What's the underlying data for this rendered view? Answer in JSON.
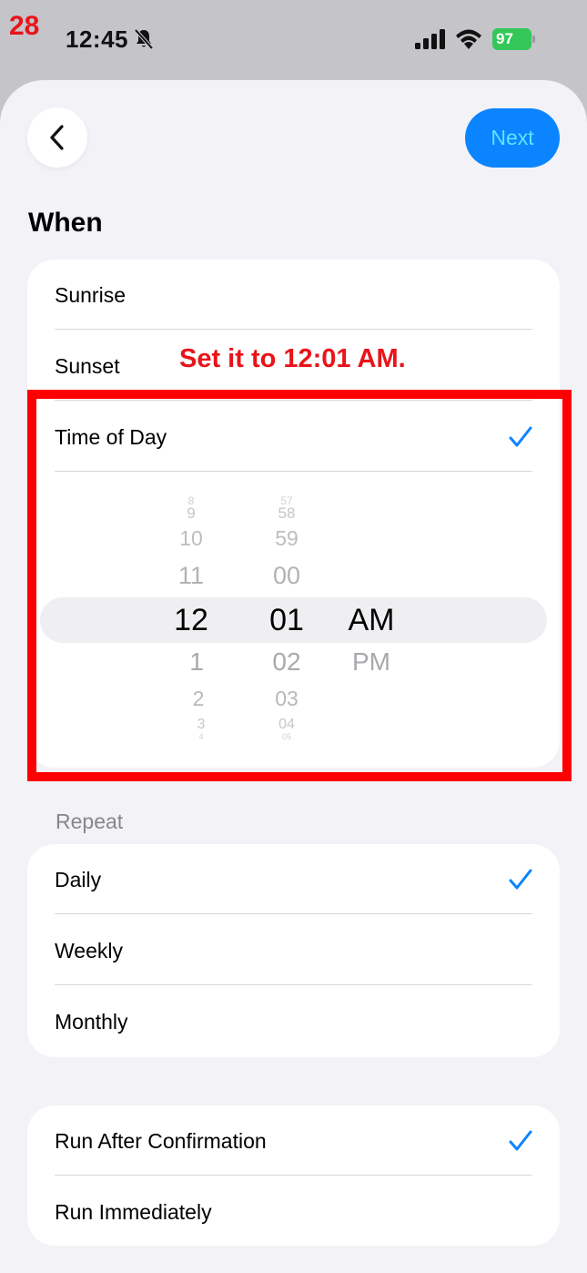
{
  "overlay": {
    "step_number": "28",
    "instruction": "Set it to 12:01 AM."
  },
  "status_bar": {
    "time": "12:45",
    "battery": "97"
  },
  "header": {
    "back_icon": "chevron-left-icon",
    "next_label": "Next"
  },
  "when": {
    "title": "When",
    "options": [
      {
        "label": "Sunrise",
        "checked": false
      },
      {
        "label": "Sunset",
        "checked": false
      },
      {
        "label": "Time of Day",
        "checked": true
      }
    ]
  },
  "time_picker": {
    "hours": [
      "8",
      "9",
      "10",
      "11",
      "12",
      "1",
      "2",
      "3",
      "4"
    ],
    "minutes": [
      "57",
      "58",
      "59",
      "00",
      "01",
      "02",
      "03",
      "04",
      "05"
    ],
    "periods": [
      "AM",
      "PM"
    ],
    "selected": {
      "hour": "12",
      "minute": "01",
      "period": "AM"
    }
  },
  "repeat": {
    "title": "Repeat",
    "options": [
      {
        "label": "Daily",
        "checked": true
      },
      {
        "label": "Weekly",
        "checked": false
      },
      {
        "label": "Monthly",
        "checked": false
      }
    ]
  },
  "run_mode": {
    "options": [
      {
        "label": "Run After Confirmation",
        "checked": true
      },
      {
        "label": "Run Immediately",
        "checked": false
      }
    ]
  },
  "colors": {
    "accent": "#0a84ff",
    "annotation_red": "#e8141a",
    "battery_green": "#34c759"
  }
}
